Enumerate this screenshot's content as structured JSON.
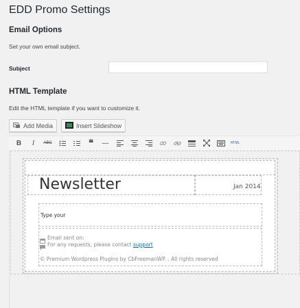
{
  "page_title": "EDD Promo Settings",
  "email_options": {
    "heading": "Email Options",
    "description": "Set your own email subject.",
    "subject_label": "Subject",
    "subject_value": "",
    "subject_placeholder": ""
  },
  "html_template": {
    "heading": "HTML Template",
    "description": "Edit the HTML template if you want to customize it.",
    "add_media_label": "Add Media",
    "insert_slideshow_label": "Insert Slideshow"
  },
  "toolbar": {
    "bold": "B",
    "italic": "I",
    "strike": "ABC",
    "quote": "❝",
    "hr": "—",
    "html_label": "HTML"
  },
  "editor": {
    "newsletter_title": "Newsletter",
    "date": "Jan 2014",
    "body_text": "Type your",
    "email_sent_on": "Email sent on:",
    "requests_text": "For any requests, please contact",
    "support_link": "support",
    "copyright": "© Premium Wordpress Plugins by CbFreemanWP. . All rights reserved"
  }
}
